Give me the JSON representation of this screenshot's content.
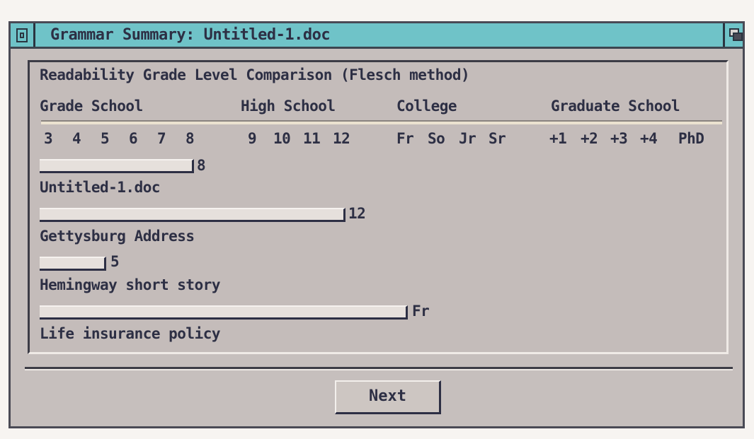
{
  "window": {
    "title": "Grammar Summary: Untitled-1.doc"
  },
  "panel": {
    "heading": "Readability Grade Level Comparison (Flesch method)",
    "categories": [
      "Grade School",
      "High School",
      "College",
      "Graduate School"
    ],
    "levels": [
      "3",
      "4",
      "5",
      "6",
      "7",
      "8",
      "9",
      "10",
      "11",
      "12",
      "Fr",
      "So",
      "Jr",
      "Sr",
      "+1",
      "+2",
      "+3",
      "+4",
      "PhD"
    ]
  },
  "results": [
    {
      "document": "Untitled-1.doc",
      "level_label": "8",
      "level_index": 5
    },
    {
      "document": "Gettysburg Address",
      "level_label": "12",
      "level_index": 9
    },
    {
      "document": "Hemingway short story",
      "level_label": "5",
      "level_index": 2
    },
    {
      "document": "Life insurance policy",
      "level_label": "Fr",
      "level_index": 10
    }
  ],
  "buttons": {
    "next_label": "Next"
  },
  "colors": {
    "titlebar": "#6fc3c8",
    "window_background": "#c6bfbd",
    "text": "#2d2f44",
    "bar_fill": "#e6e0dc"
  }
}
